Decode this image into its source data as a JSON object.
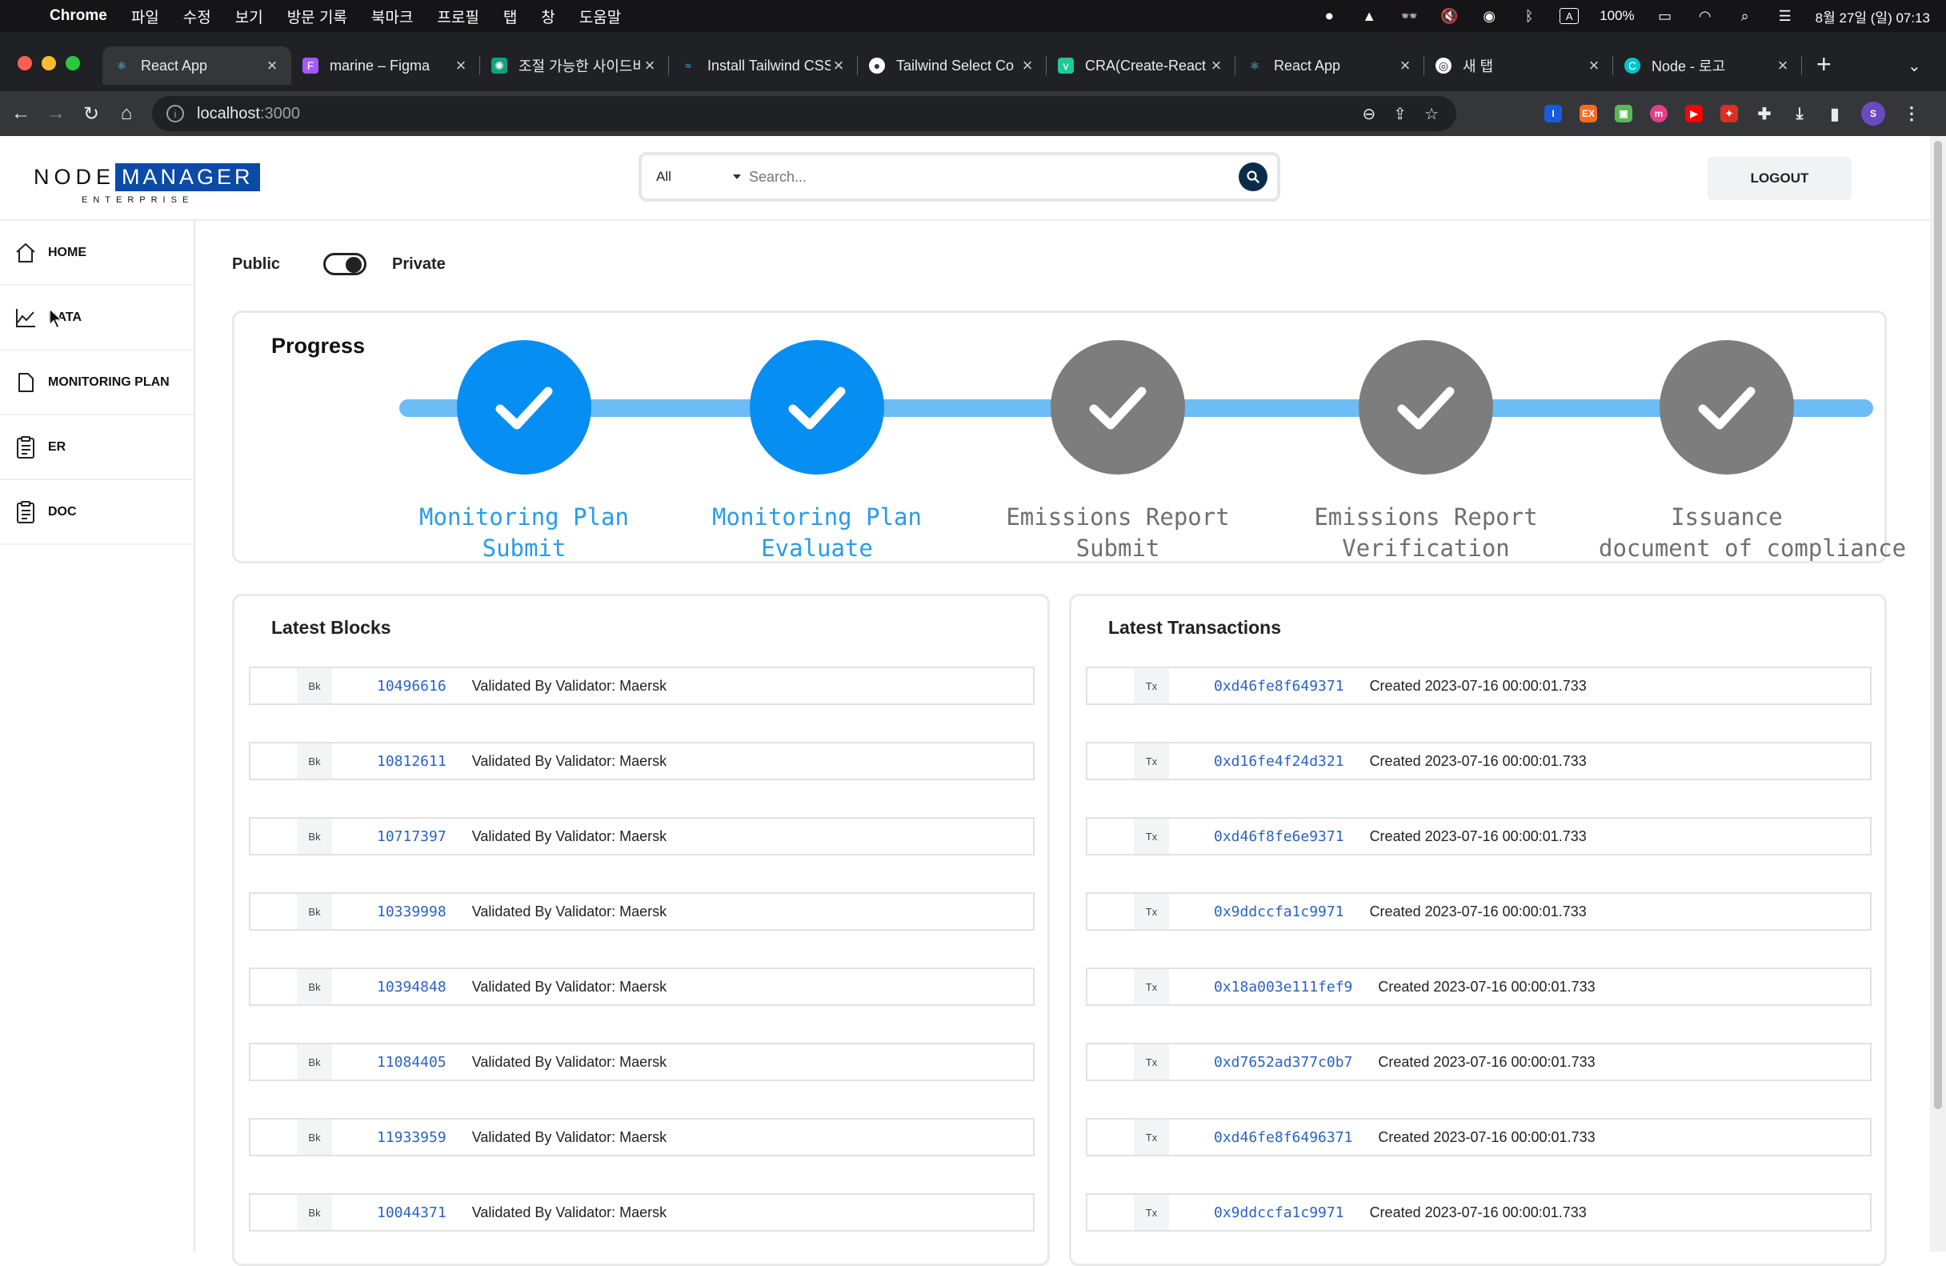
{
  "menubar": {
    "app": "Chrome",
    "items": [
      "파일",
      "수정",
      "보기",
      "방문 기록",
      "북마크",
      "프로필",
      "탭",
      "창",
      "도움말"
    ],
    "battery": "100%",
    "datetime": "8월 27일 (일) 07:13"
  },
  "tabs": [
    {
      "title": "React App",
      "favicon": "react-icon",
      "active": true
    },
    {
      "title": "marine – Figma",
      "favicon": "figma-icon"
    },
    {
      "title": "조절 가능한 사이드바",
      "favicon": "chatgpt-icon"
    },
    {
      "title": "Install Tailwind CSS",
      "favicon": "tailwind-icon"
    },
    {
      "title": "Tailwind Select Co",
      "favicon": "tailwind-select-icon"
    },
    {
      "title": "CRA(Create-React",
      "favicon": "velog-icon"
    },
    {
      "title": "React App",
      "favicon": "react-icon"
    },
    {
      "title": "새 탭",
      "favicon": "chrome-icon"
    },
    {
      "title": "Node - 로고",
      "favicon": "canva-icon"
    }
  ],
  "address": {
    "host": "localhost",
    "port": ":3000"
  },
  "profile_initial": "S",
  "header": {
    "logo_node": "NODE",
    "logo_manager": "MANAGER",
    "logo_enterprise": "ENTERPRISE",
    "search_scope": "All",
    "search_placeholder": "Search...",
    "logout_label": "LOGOUT"
  },
  "sidebar": {
    "items": [
      {
        "label": "HOME",
        "icon": "home-icon"
      },
      {
        "label": "DATA",
        "icon": "chart-icon"
      },
      {
        "label": "MONITORING PLAN",
        "icon": "document-icon"
      },
      {
        "label": "ER",
        "icon": "clipboard-icon"
      },
      {
        "label": "DOC",
        "icon": "clipboard-icon"
      }
    ]
  },
  "visibility": {
    "public_label": "Public",
    "private_label": "Private",
    "private_selected": true
  },
  "progress": {
    "title": "Progress",
    "steps": [
      {
        "line1": "Monitoring Plan",
        "line2": "Submit",
        "done": true
      },
      {
        "line1": "Monitoring Plan",
        "line2": "Evaluate",
        "done": true
      },
      {
        "line1": "Emissions Report",
        "line2": "Submit",
        "done": false
      },
      {
        "line1": "Emissions Report",
        "line2": "Verification",
        "done": false
      },
      {
        "line1": "Issuance",
        "line2": "document of compliance",
        "done": false
      }
    ]
  },
  "blocks": {
    "title": "Latest Blocks",
    "badge": "Bk",
    "rows": [
      {
        "id": "10496616",
        "desc": "Validated By Validator: Maersk"
      },
      {
        "id": "10812611",
        "desc": "Validated By Validator: Maersk"
      },
      {
        "id": "10717397",
        "desc": "Validated By Validator: Maersk"
      },
      {
        "id": "10339998",
        "desc": "Validated By Validator: Maersk"
      },
      {
        "id": "10394848",
        "desc": "Validated By Validator: Maersk"
      },
      {
        "id": "11084405",
        "desc": "Validated By Validator: Maersk"
      },
      {
        "id": "11933959",
        "desc": "Validated By Validator: Maersk"
      },
      {
        "id": "10044371",
        "desc": "Validated By Validator: Maersk"
      }
    ]
  },
  "transactions": {
    "title": "Latest Transactions",
    "badge": "Tx",
    "rows": [
      {
        "id": "0xd46fe8f649371",
        "desc": "Created 2023-07-16 00:00:01.733"
      },
      {
        "id": "0xd16fe4f24d321",
        "desc": "Created 2023-07-16 00:00:01.733"
      },
      {
        "id": "0xd46f8fe6e9371",
        "desc": "Created 2023-07-16 00:00:01.733"
      },
      {
        "id": "0x9ddccfa1c9971",
        "desc": "Created 2023-07-16 00:00:01.733"
      },
      {
        "id": "0x18a003e111fef9",
        "desc": "Created 2023-07-16 00:00:01.733"
      },
      {
        "id": "0xd7652ad377c0b7",
        "desc": "Created 2023-07-16 00:00:01.733"
      },
      {
        "id": "0xd46fe8f6496371",
        "desc": "Created 2023-07-16 00:00:01.733"
      },
      {
        "id": "0x9ddccfa1c9971",
        "desc": "Created 2023-07-16 00:00:01.733"
      }
    ]
  },
  "colors": {
    "accent": "#078ef2",
    "pending": "#7d7d7d",
    "track": "#6cbdf5",
    "hash": "#2a63c4"
  }
}
